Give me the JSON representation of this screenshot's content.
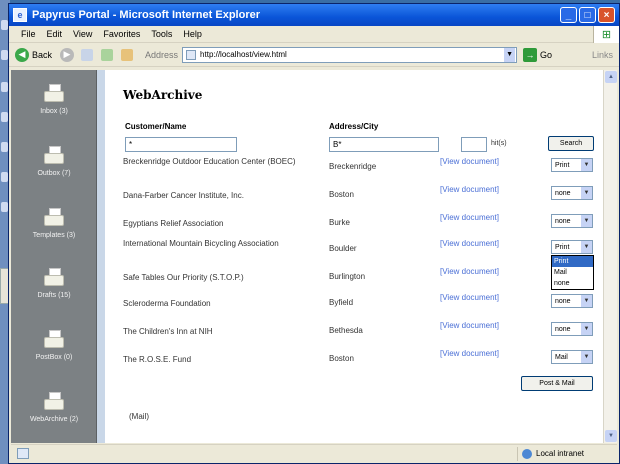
{
  "window": {
    "title": "Papyrus Portal - Microsoft Internet Explorer",
    "controls": [
      "_",
      "□",
      "×"
    ]
  },
  "menu": [
    "File",
    "Edit",
    "View",
    "Favorites",
    "Tools",
    "Help"
  ],
  "toolbar": {
    "back_label": "Back",
    "address_label": "Address",
    "address_value": "http://localhost/view.html",
    "go_label": "Go",
    "links_label": "Links"
  },
  "sidebar": {
    "items": [
      {
        "label": "Inbox (3)"
      },
      {
        "label": "Outbox (7)"
      },
      {
        "label": "Templates (3)"
      },
      {
        "label": "Drafts (15)"
      },
      {
        "label": "PostBox (0)"
      },
      {
        "label": "WebArchive (2)"
      }
    ]
  },
  "main": {
    "title": "WebArchive",
    "headers": {
      "name": "Customer/Name",
      "city": "Address/City"
    },
    "search": {
      "name_value": "*",
      "city_value": "B*",
      "hits_value": "",
      "hits_label": "hit(s)",
      "button": "Search"
    },
    "link_label": "[View document]",
    "rows": [
      {
        "name": "Breckenridge Outdoor Education Center (BOEC)",
        "city": "Breckenridge",
        "option": "Print"
      },
      {
        "name": "Dana-Farber Cancer Institute, Inc.",
        "city": "Boston",
        "option": "none"
      },
      {
        "name": "Egyptians Relief Association",
        "city": "Burke",
        "option": "none"
      },
      {
        "name": "International Mountain Bicycling Association",
        "city": "Boulder",
        "option": "Print"
      },
      {
        "name": "Safe Tables Our Priority (S.T.O.P.)",
        "city": "Burlington",
        "option": ""
      },
      {
        "name": "Scleroderma Foundation",
        "city": "Byfield",
        "option": "none"
      },
      {
        "name": "The Children's Inn at NIH",
        "city": "Bethesda",
        "option": "none"
      },
      {
        "name": "The R.O.S.E. Fund",
        "city": "Boston",
        "option": "Mail"
      }
    ],
    "dropdown_options": [
      "Print",
      "Mail",
      "none"
    ],
    "submit_button": "Post & Mail",
    "footer": "(Mail)"
  },
  "status": {
    "zone": "Local intranet"
  }
}
